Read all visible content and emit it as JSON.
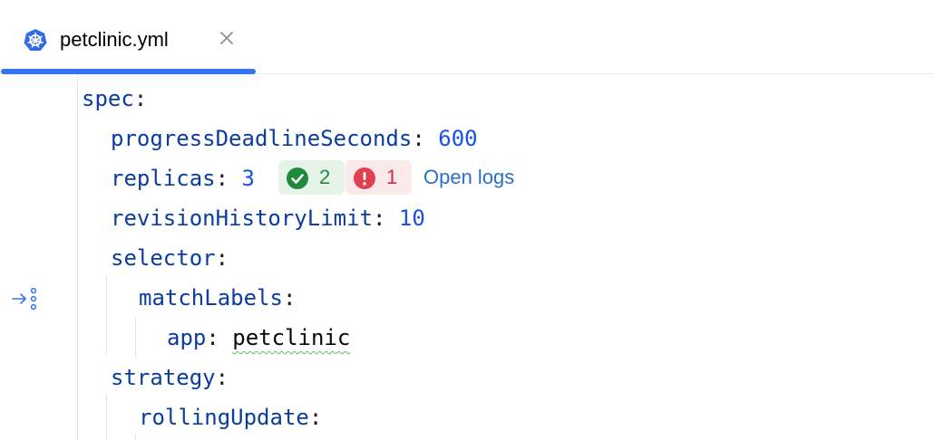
{
  "tab": {
    "title": "petclinic.yml",
    "icon": "kubernetes-icon",
    "close_icon": "close-icon",
    "accent": "#3574f0"
  },
  "editor": {
    "lines": [
      {
        "key": "spec",
        "sep": ":",
        "value": ""
      },
      {
        "key": "progressDeadlineSeconds",
        "sep": ": ",
        "value": "600"
      },
      {
        "key": "replicas",
        "sep": ": ",
        "value": "3"
      },
      {
        "key": "revisionHistoryLimit",
        "sep": ": ",
        "value": "10"
      },
      {
        "key": "selector",
        "sep": ":",
        "value": ""
      },
      {
        "key": "matchLabels",
        "sep": ":",
        "value": ""
      },
      {
        "key": "app",
        "sep": ": ",
        "value": "petclinic"
      },
      {
        "key": "strategy",
        "sep": ":",
        "value": ""
      },
      {
        "key": "rollingUpdate",
        "sep": ":",
        "value": ""
      }
    ],
    "replicas_status": {
      "ready_count": "2",
      "error_count": "1",
      "open_logs_label": "Open logs",
      "ready_color": "#208a3c",
      "error_color": "#d6293b"
    },
    "gutter_icon": "navigate-to-labels-icon"
  }
}
